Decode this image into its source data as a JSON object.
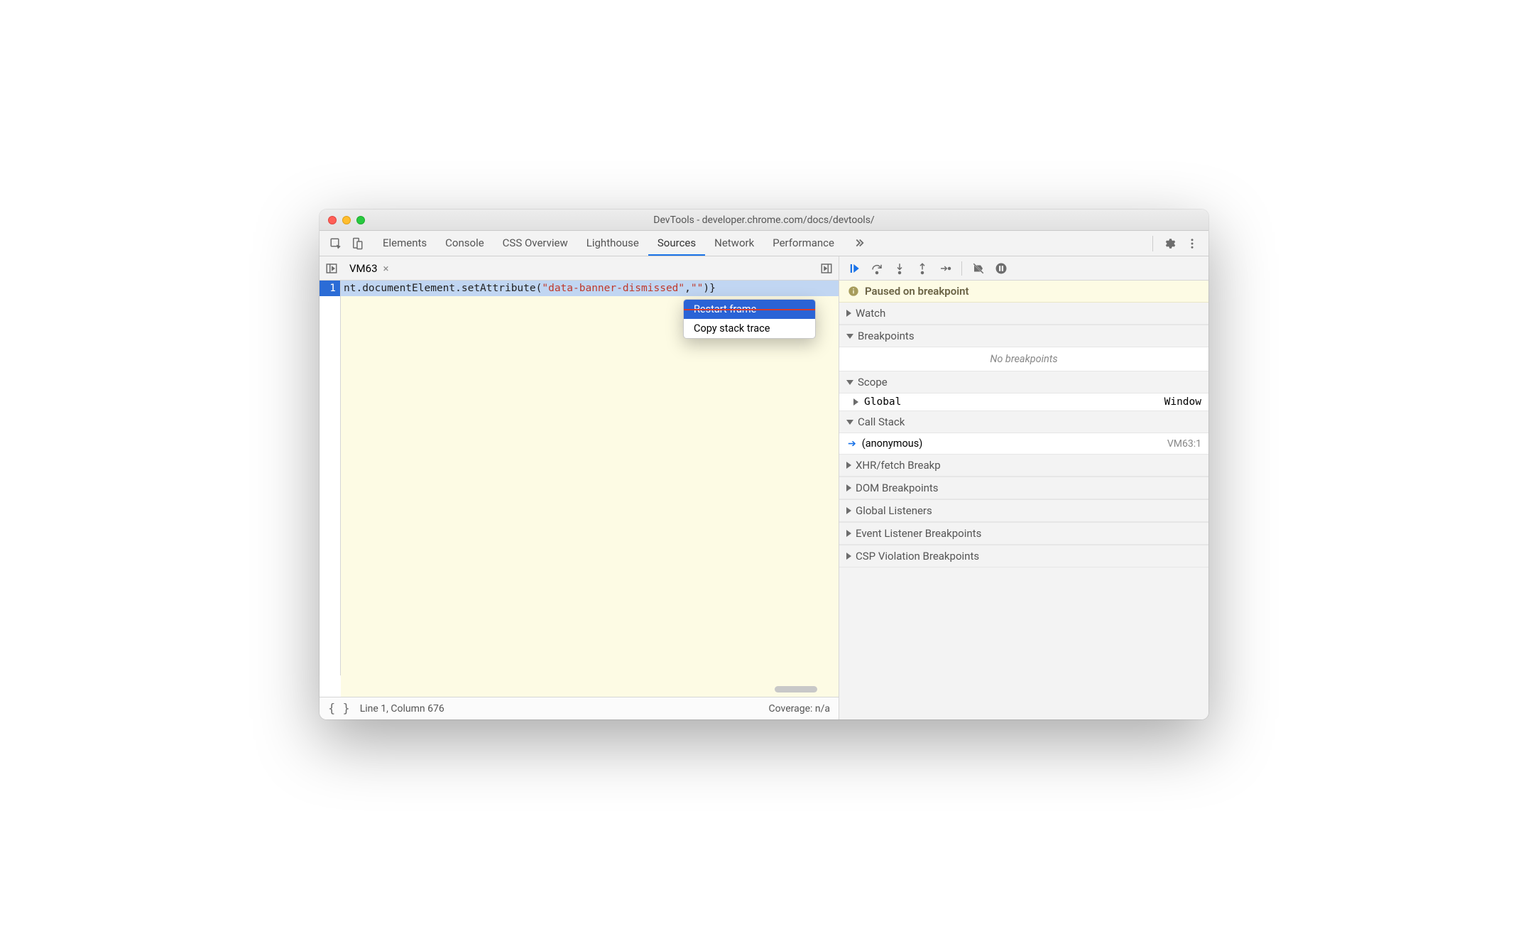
{
  "window": {
    "title": "DevTools - developer.chrome.com/docs/devtools/"
  },
  "tabs": {
    "items": [
      "Elements",
      "Console",
      "CSS Overview",
      "Lighthouse",
      "Sources",
      "Network",
      "Performance"
    ],
    "activeIndex": 4
  },
  "source": {
    "tabName": "VM63",
    "lineNumber": "1",
    "codePrefix": "nt.documentElement.setAttribute(",
    "codeString": "\"data-banner-dismissed\"",
    "codeMid": ",",
    "codeString2": "\"\"",
    "codeSuffix": ")}"
  },
  "statusBar": {
    "position": "Line 1, Column 676",
    "coverage": "Coverage: n/a"
  },
  "debugger": {
    "pausedMessage": "Paused on breakpoint",
    "sections": {
      "watch": "Watch",
      "breakpoints": "Breakpoints",
      "noBreakpoints": "No breakpoints",
      "scope": "Scope",
      "scopeGlobal": "Global",
      "scopeGlobalValue": "Window",
      "callStack": "Call Stack",
      "stackFrame": "(anonymous)",
      "stackLocation": "VM63:1",
      "xhr": "XHR/fetch Breakp",
      "dom": "DOM Breakpoints",
      "globalListeners": "Global Listeners",
      "eventListener": "Event Listener Breakpoints",
      "csp": "CSP Violation Breakpoints"
    }
  },
  "contextMenu": {
    "restartFrame": "Restart frame",
    "copyStack": "Copy stack trace"
  }
}
